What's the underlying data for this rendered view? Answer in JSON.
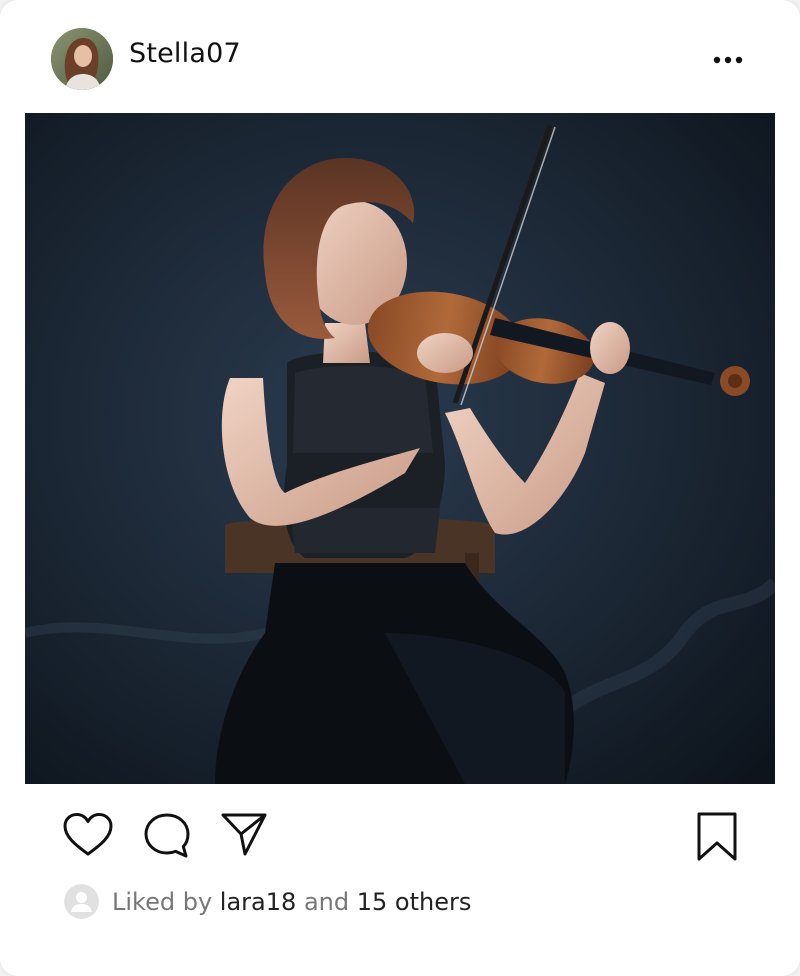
{
  "post": {
    "username": "Stella07",
    "more_icon": "more-horizontal-icon",
    "image_alt": "woman playing violin"
  },
  "actions": {
    "like_icon": "heart-icon",
    "comment_icon": "comment-bubble-icon",
    "share_icon": "paper-plane-icon",
    "save_icon": "bookmark-icon"
  },
  "likes": {
    "prefix": "Liked by",
    "user": "lara18",
    "connector": "and",
    "others": "15 others"
  },
  "colors": {
    "background": "#ffffff",
    "text_primary": "#111111",
    "text_muted": "#777777",
    "icon_stroke": "#111111"
  }
}
